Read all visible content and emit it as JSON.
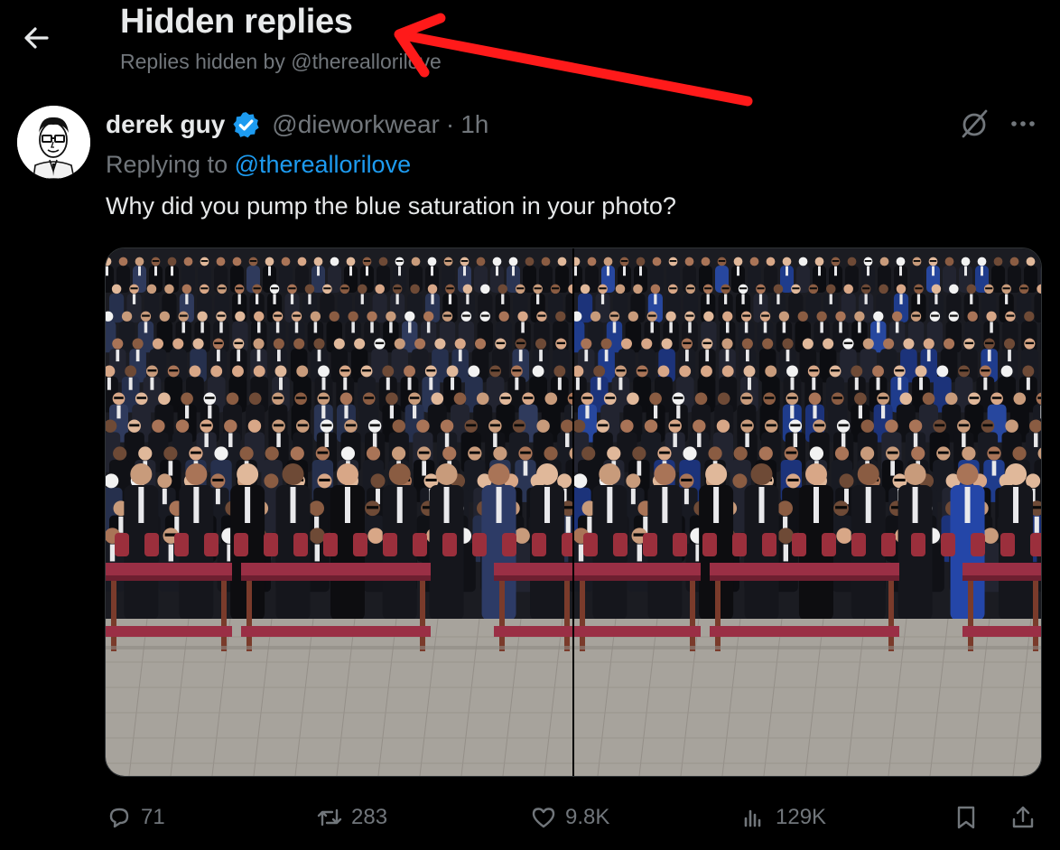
{
  "header": {
    "title": "Hidden replies",
    "subtitle": "Replies hidden by @thereallorilove"
  },
  "tweet": {
    "author_name": "derek guy",
    "handle": "@dieworkwear",
    "separator": "·",
    "time": "1h",
    "replying_prefix": "Replying to ",
    "replying_to": "@thereallorilove",
    "text": "Why did you pump the blue saturation in your photo?"
  },
  "actions": {
    "replies": "71",
    "reposts": "283",
    "likes": "9.8K",
    "views": "129K"
  },
  "colors": {
    "background": "#000000",
    "text": "#e7e9ea",
    "secondary": "#71767b",
    "link": "#1d9bf0",
    "verified": "#1d9bf0",
    "annotation_arrow": "#ff1a1a"
  },
  "icons": {
    "back": "arrow-left-icon",
    "verified": "verified-badge-icon",
    "grok": "slashed-circle-icon",
    "more": "more-dots-icon",
    "reply": "reply-bubble-icon",
    "repost": "repost-icon",
    "like": "heart-icon",
    "views": "views-chart-icon",
    "bookmark": "bookmark-icon",
    "share": "share-icon"
  }
}
